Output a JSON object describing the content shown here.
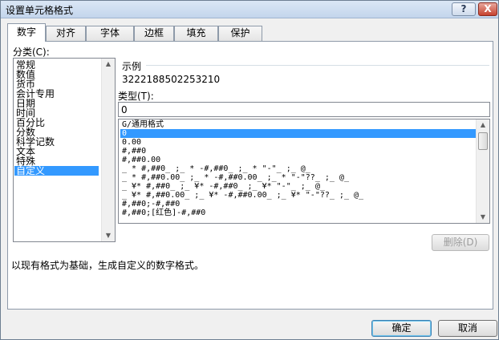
{
  "window": {
    "title": "设置单元格格式",
    "help_label": "?",
    "close_label": "X"
  },
  "tabs": [
    "数字",
    "对齐",
    "字体",
    "边框",
    "填充",
    "保护"
  ],
  "category": {
    "label": "分类(C):",
    "items": [
      "常规",
      "数值",
      "货币",
      "会计专用",
      "日期",
      "时间",
      "百分比",
      "分数",
      "科学记数",
      "文本",
      "特殊",
      "自定义"
    ],
    "selected": "自定义"
  },
  "sample": {
    "label": "示例",
    "value": "3222188502253210"
  },
  "type_field": {
    "label": "类型(T):",
    "value": "0"
  },
  "formats": [
    "G/通用格式",
    "0",
    "0.00",
    "#,##0",
    "#,##0.00",
    "_ * #,##0_ ;_ * -#,##0_ ;_ * \"-\"_ ;_ @_",
    "_ * #,##0.00_ ;_ * -#,##0.00_ ;_ * \"-\"??_ ;_ @_",
    "_ ¥* #,##0_ ;_ ¥* -#,##0_ ;_ ¥* \"-\"_ ;_ @_",
    "_ ¥* #,##0.00_ ;_ ¥* -#,##0.00_ ;_ ¥* \"-\"??_ ;_ @_",
    "#,##0;-#,##0",
    "#,##0;[红色]-#,##0"
  ],
  "selected_format": "0",
  "delete_button": "删除(D)",
  "description": "以现有格式为基础，生成自定义的数字格式。",
  "ok_button": "确定",
  "cancel_button": "取消",
  "colors": {
    "selection": "#3399ff",
    "title_bar": "#c3d5ec"
  }
}
